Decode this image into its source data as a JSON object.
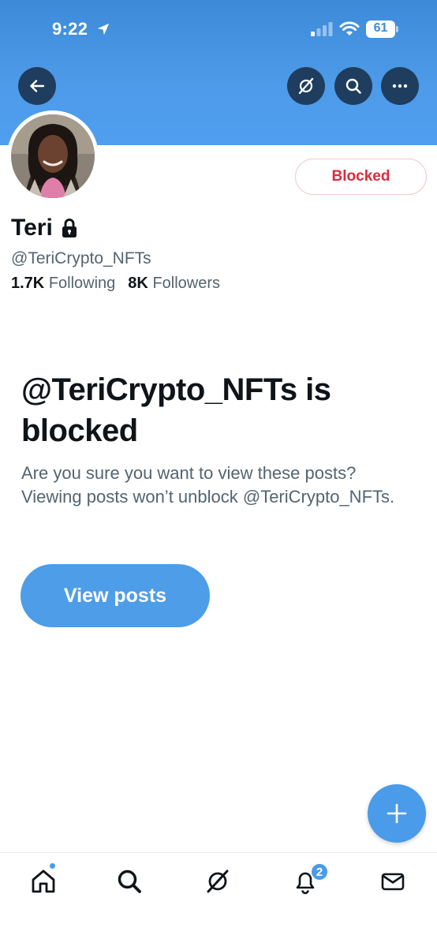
{
  "status_bar": {
    "time": "9:22",
    "battery_level": "61",
    "signal_bars_active": 1,
    "signal_bars_total": 4
  },
  "header": {
    "back_icon": "arrow-left-icon",
    "grok_icon": "grok-icon",
    "search_icon": "search-icon",
    "more_icon": "ellipsis-icon"
  },
  "profile": {
    "display_name": "Teri",
    "protected_icon": "lock-icon",
    "handle": "@TeriCrypto_NFTs",
    "following_count": "1.7K",
    "following_label": "Following",
    "followers_count": "8K",
    "followers_label": "Followers",
    "blocked_button_label": "Blocked"
  },
  "blocked_notice": {
    "title": "@TeriCrypto_NFTs is blocked",
    "description": "Are you sure you want to view these posts? Viewing posts won’t unblock @TeriCrypto_NFTs.",
    "view_posts_label": "View posts"
  },
  "fab": {
    "icon": "plus-icon"
  },
  "tab_bar": {
    "items": [
      {
        "name": "home",
        "icon": "home-icon",
        "has_dot": true
      },
      {
        "name": "search",
        "icon": "search-icon"
      },
      {
        "name": "grok",
        "icon": "grok-icon"
      },
      {
        "name": "notifications",
        "icon": "bell-icon",
        "badge": "2"
      },
      {
        "name": "messages",
        "icon": "envelope-icon"
      }
    ]
  },
  "colors": {
    "accent": "#4d9de8",
    "banner": "#4d9be9",
    "blocked_red": "#dd2a3a",
    "secondary_text": "#536471",
    "primary_text": "#0f1419"
  }
}
